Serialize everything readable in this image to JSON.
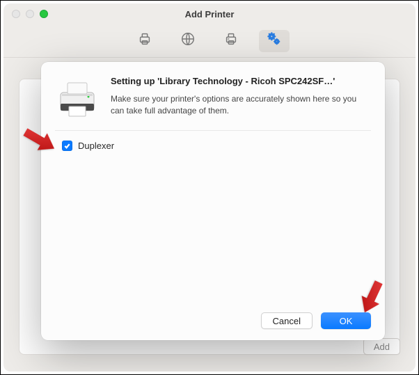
{
  "window": {
    "title": "Add Printer"
  },
  "toolbar": {
    "items": [
      {
        "name": "printer-icon"
      },
      {
        "name": "globe-icon"
      },
      {
        "name": "fax-icon"
      },
      {
        "name": "advanced-icon",
        "selected": true
      }
    ]
  },
  "bottom": {
    "add_label": "Add"
  },
  "sheet": {
    "heading": "Setting up 'Library Technology - Ricoh SPC242SF…'",
    "subtext": "Make sure your printer's options are accurately shown here so you can take full advantage of them.",
    "options": [
      {
        "label": "Duplexer",
        "checked": true
      }
    ],
    "cancel_label": "Cancel",
    "ok_label": "OK"
  },
  "annotations": {
    "arrow_color": "#d11919"
  }
}
